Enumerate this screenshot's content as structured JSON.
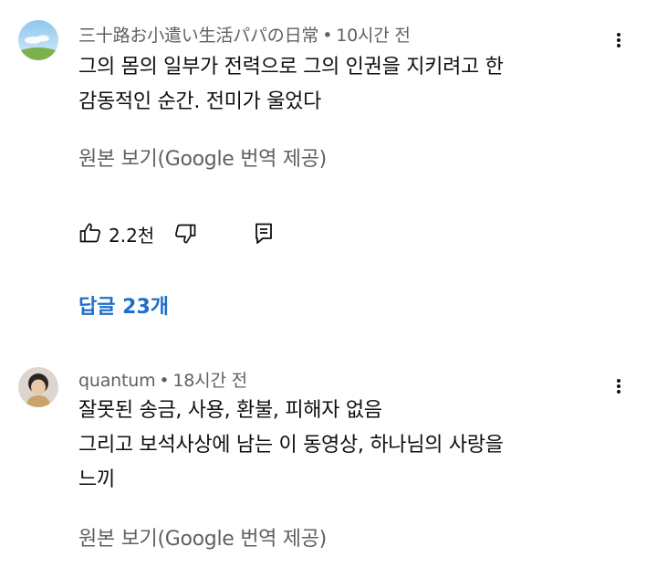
{
  "comments": [
    {
      "author": "三十路お小遣い生活パパの日常",
      "time": "10시간 전",
      "lines": [
        "그의 몸의 일부가 전력으로 그의 인권을 지키려고 한",
        "감동적인 순간. 전미가 울었다"
      ],
      "translate_label": "원본 보기(Google 번역 제공)",
      "likes": "2.2천",
      "replies_label": "답글 23개",
      "avatar_icon": "sky-landscape-avatar"
    },
    {
      "author": "quantum",
      "time": "18시간 전",
      "lines": [
        "잘못된 송금, 사용, 환불, 피해자 없음",
        "그리고 보석사상에 남는 이 동영상, 하나님의 사랑을",
        "느끼"
      ],
      "translate_label": "원본 보기(Google 번역 제공)",
      "avatar_icon": "person-avatar"
    }
  ],
  "separator": "•",
  "icons": {
    "more": "more-vert-icon",
    "like": "thumbs-up-icon",
    "dislike": "thumbs-down-icon",
    "reply": "reply-icon"
  },
  "colors": {
    "link": "#1f6fc9",
    "secondary_text": "#606060",
    "primary_text": "#0f0f0f"
  }
}
